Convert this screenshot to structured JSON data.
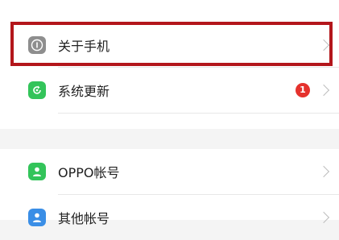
{
  "settings": {
    "items": [
      {
        "label": "关于手机",
        "icon": "info-icon",
        "icon_bg": "#8e8e8e"
      },
      {
        "label": "系统更新",
        "icon": "update-icon",
        "icon_bg": "#33c45a",
        "badge": "1"
      },
      {
        "label": "OPPO帐号",
        "icon": "account-icon",
        "icon_bg": "#33c45a"
      },
      {
        "label": "其他帐号",
        "icon": "other-account-icon",
        "icon_bg": "#3a8ee6"
      }
    ]
  },
  "colors": {
    "highlight": "#b3161b",
    "badge": "#e5322d"
  }
}
